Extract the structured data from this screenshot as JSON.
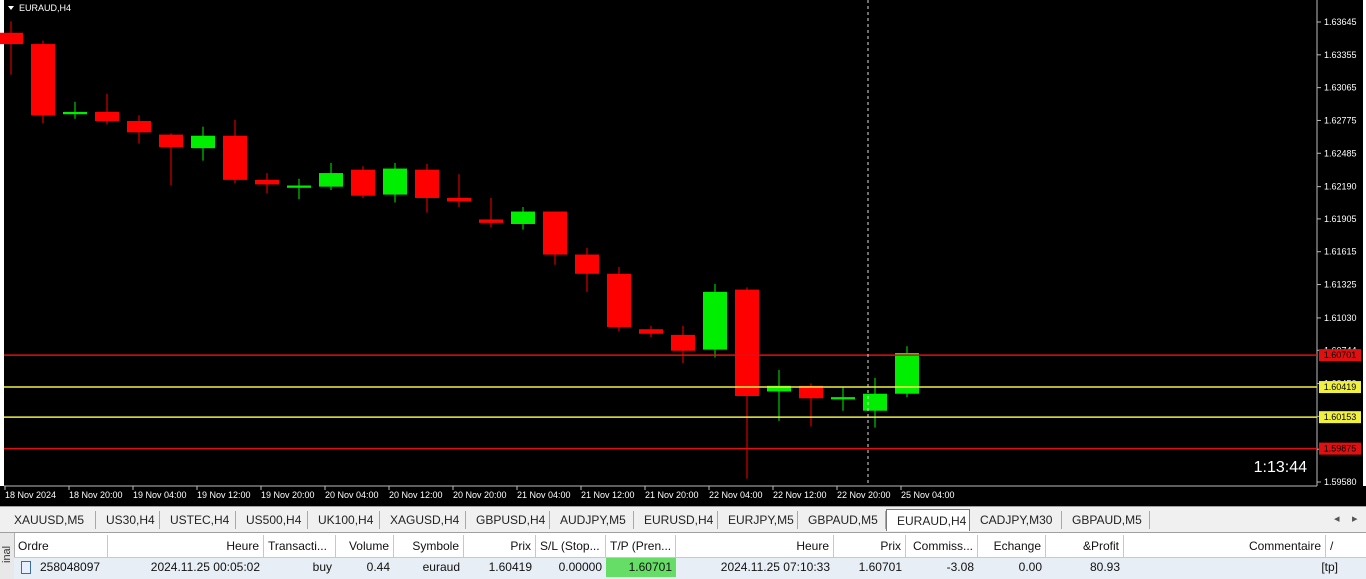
{
  "chart": {
    "title": "EURAUD,H4",
    "countdown": "1:13:44",
    "colors": {
      "background": "#000000",
      "bull": "#00ee00",
      "bear": "#ff0000",
      "tp_sl_line": "#e01010",
      "entry_line": "#f0f040",
      "grid_text": "#ffffff"
    },
    "price_axis": [
      "1.63645",
      "1.63355",
      "1.63065",
      "1.62775",
      "1.62485",
      "1.62190",
      "1.61905",
      "1.61615",
      "1.61325",
      "1.61030",
      "1.60744",
      "1.60450",
      "1.60160",
      "1.59870",
      "1.59580"
    ],
    "level_tags": [
      {
        "label": "1.60701",
        "color": "#e01010",
        "price": 1.60701
      },
      {
        "label": "1.60419",
        "color": "#f0f040",
        "price": 1.60419
      },
      {
        "label": "1.60153",
        "color": "#f0f040",
        "price": 1.60153
      },
      {
        "label": "1.59875",
        "color": "#e01010",
        "price": 1.59875
      }
    ],
    "time_axis": [
      "18 Nov 2024",
      "18 Nov 20:00",
      "19 Nov 04:00",
      "19 Nov 12:00",
      "19 Nov 20:00",
      "20 Nov 04:00",
      "20 Nov 12:00",
      "20 Nov 20:00",
      "21 Nov 04:00",
      "21 Nov 12:00",
      "21 Nov 20:00",
      "22 Nov 04:00",
      "22 Nov 12:00",
      "22 Nov 20:00",
      "25 Nov 04:00"
    ]
  },
  "chart_data": {
    "type": "candlestick",
    "symbol": "EURAUD",
    "timeframe": "H4",
    "y_range": [
      1.5958,
      1.63645
    ],
    "ohlc": [
      [
        1.6355,
        1.6365,
        1.6318,
        1.6345
      ],
      [
        1.6345,
        1.6348,
        1.6275,
        1.6282
      ],
      [
        1.6283,
        1.6294,
        1.6279,
        1.6285
      ],
      [
        1.6285,
        1.6301,
        1.6274,
        1.6277
      ],
      [
        1.6277,
        1.6282,
        1.6257,
        1.6267
      ],
      [
        1.6265,
        1.6266,
        1.622,
        1.6254
      ],
      [
        1.6253,
        1.6272,
        1.6242,
        1.6264
      ],
      [
        1.6264,
        1.6278,
        1.6222,
        1.6225
      ],
      [
        1.6225,
        1.6231,
        1.6213,
        1.6221
      ],
      [
        1.6218,
        1.6226,
        1.6208,
        1.622
      ],
      [
        1.6219,
        1.624,
        1.6216,
        1.6231
      ],
      [
        1.6234,
        1.6237,
        1.6209,
        1.6211
      ],
      [
        1.6212,
        1.624,
        1.6205,
        1.6235
      ],
      [
        1.6234,
        1.6239,
        1.6196,
        1.6209
      ],
      [
        1.6209,
        1.623,
        1.6201,
        1.6206
      ],
      [
        1.619,
        1.6209,
        1.6183,
        1.6187
      ],
      [
        1.6186,
        1.6201,
        1.6181,
        1.6197
      ],
      [
        1.6197,
        1.6197,
        1.615,
        1.6159
      ],
      [
        1.6159,
        1.6165,
        1.6126,
        1.6142
      ],
      [
        1.6142,
        1.6148,
        1.6091,
        1.6095
      ],
      [
        1.6093,
        1.6096,
        1.6086,
        1.6089
      ],
      [
        1.6088,
        1.6096,
        1.6063,
        1.6074
      ],
      [
        1.6075,
        1.6133,
        1.6068,
        1.6126
      ],
      [
        1.6128,
        1.613,
        1.5961,
        1.6034
      ],
      [
        1.6038,
        1.6057,
        1.6012,
        1.6043
      ],
      [
        1.6043,
        1.6045,
        1.6007,
        1.6032
      ],
      [
        1.6031,
        1.6042,
        1.6021,
        1.6033
      ],
      [
        1.6021,
        1.605,
        1.6006,
        1.6036
      ],
      [
        1.6036,
        1.6078,
        1.6033,
        1.6072
      ]
    ],
    "horizontal_lines": [
      {
        "price": 1.60701,
        "type": "take-profit"
      },
      {
        "price": 1.60419,
        "type": "entry"
      },
      {
        "price": 1.60153,
        "type": "entry"
      },
      {
        "price": 1.59875,
        "type": "stop-loss"
      }
    ]
  },
  "tabs": [
    {
      "label": "XAUUSD,M5",
      "active": false
    },
    {
      "label": "US30,H4",
      "active": false
    },
    {
      "label": "USTEC,H4",
      "active": false
    },
    {
      "label": "US500,H4",
      "active": false
    },
    {
      "label": "UK100,H4",
      "active": false
    },
    {
      "label": "XAGUSD,H4",
      "active": false
    },
    {
      "label": "GBPUSD,H4",
      "active": false
    },
    {
      "label": "AUDJPY,M5",
      "active": false
    },
    {
      "label": "EURUSD,H4",
      "active": false
    },
    {
      "label": "EURJPY,M5",
      "active": false
    },
    {
      "label": "GBPAUD,M5",
      "active": false
    },
    {
      "label": "EURAUD,H4",
      "active": true
    },
    {
      "label": "CADJPY,M30",
      "active": false
    },
    {
      "label": "GBPAUD,M5",
      "active": false
    }
  ],
  "terminal": {
    "side_label": "inal",
    "columns": [
      "Ordre",
      "Heure",
      "Transacti...",
      "Volume",
      "Symbole",
      "Prix",
      "S/L (Stop...",
      "T/P (Pren...",
      "Heure",
      "Prix",
      "Commiss...",
      "Echange",
      "&Profit",
      "Commentaire"
    ],
    "sort_indicator": "/",
    "row": {
      "ordre": "258048097",
      "heure_open": "2024.11.25 00:05:02",
      "transaction": "buy",
      "volume": "0.44",
      "symbole": "euraud",
      "prix_open": "1.60419",
      "sl": "0.00000",
      "tp": "1.60701",
      "heure_close": "2024.11.25 07:10:33",
      "prix_close": "1.60701",
      "commission": "-3.08",
      "echange": "0.00",
      "profit": "80.93",
      "commentaire": "[tp]",
      "tp_highlight": "#66dd66"
    }
  }
}
